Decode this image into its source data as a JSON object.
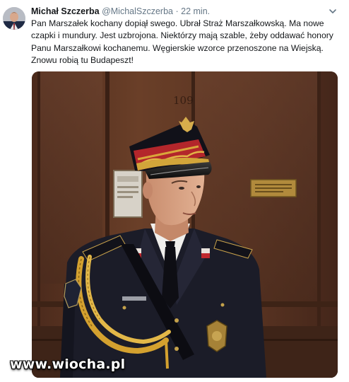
{
  "tweet": {
    "display_name": "Michał Szczerba",
    "handle": "@MichalSzczerba",
    "separator": "·",
    "timestamp": "22 min.",
    "text_lines": [
      "Pan Marszałek kochany dopiął swego. Ubrał Straż Marszałkowską. Ma nowe",
      "czapki i mundury. Jest uzbrojona. Niektórzy mają szable, żeby oddawać honory",
      "Panu Marszałkowi kochanemu. Węgierskie wzorce przenoszone na Wiejską.",
      "Znowu robią tu Budapeszt!"
    ],
    "menu_icon": "chevron-down-icon"
  },
  "photo": {
    "door_number": "109",
    "plaque_text": "PRZEWODNICZĄCY"
  },
  "watermark": "www.wiocha.pl",
  "colors": {
    "name": "#14171a",
    "secondary": "#657786",
    "wood": "#5a3524",
    "uniform": "#1c1d2a",
    "cap_band": "#b3262b",
    "braid": "#d4a12f"
  }
}
